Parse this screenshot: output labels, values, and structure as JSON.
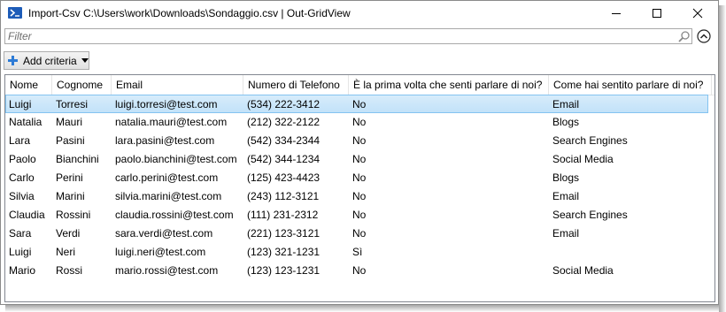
{
  "window": {
    "title": "Import-Csv C:\\Users\\work\\Downloads\\Sondaggio.csv | Out-GridView",
    "icon": "powershell-icon"
  },
  "filter": {
    "placeholder": "Filter",
    "value": ""
  },
  "toolbar": {
    "add_criteria_label": "Add criteria"
  },
  "grid": {
    "columns": [
      "Nome",
      "Cognome",
      "Email",
      "Numero di Telefono",
      "È la prima volta che senti parlare di noi?",
      "Come hai sentito parlare di noi?"
    ],
    "rows": [
      [
        "Luigi",
        "Torresi",
        "luigi.torresi@test.com",
        "(534) 222-3412",
        "No",
        "Email"
      ],
      [
        "Natalia",
        "Mauri",
        "natalia.mauri@test.com",
        "(212) 322-2122",
        "No",
        "Blogs"
      ],
      [
        "Lara",
        "Pasini",
        "lara.pasini@test.com",
        "(542) 334-2344",
        "No",
        "Search Engines"
      ],
      [
        "Paolo",
        "Bianchini",
        "paolo.bianchini@test.com",
        "(542) 344-1234",
        "No",
        "Social Media"
      ],
      [
        "Carlo",
        "Perini",
        "carlo.perini@test.com",
        "(125) 423-4423",
        "No",
        "Blogs"
      ],
      [
        "Silvia",
        "Marini",
        "silvia.marini@test.com",
        "(243) 112-3121",
        "No",
        "Email"
      ],
      [
        "Claudia",
        "Rossini",
        "claudia.rossini@test.com",
        "(111) 231-2312",
        "No",
        "Search Engines"
      ],
      [
        "Sara",
        "Verdi",
        "sara.verdi@test.com",
        "(221) 123-3121",
        "No",
        "Email"
      ],
      [
        "Luigi",
        "Neri",
        "luigi.neri@test.com",
        "(123) 321-1231",
        "Sì",
        ""
      ],
      [
        "Mario",
        "Rossi",
        "mario.rossi@test.com",
        "(123) 123-1231",
        "No",
        "Social Media"
      ]
    ],
    "selected_row": 0
  },
  "colors": {
    "selection": "#c2e2f9",
    "selection_border": "#84c3f0",
    "accent": "#1d5cb8"
  }
}
